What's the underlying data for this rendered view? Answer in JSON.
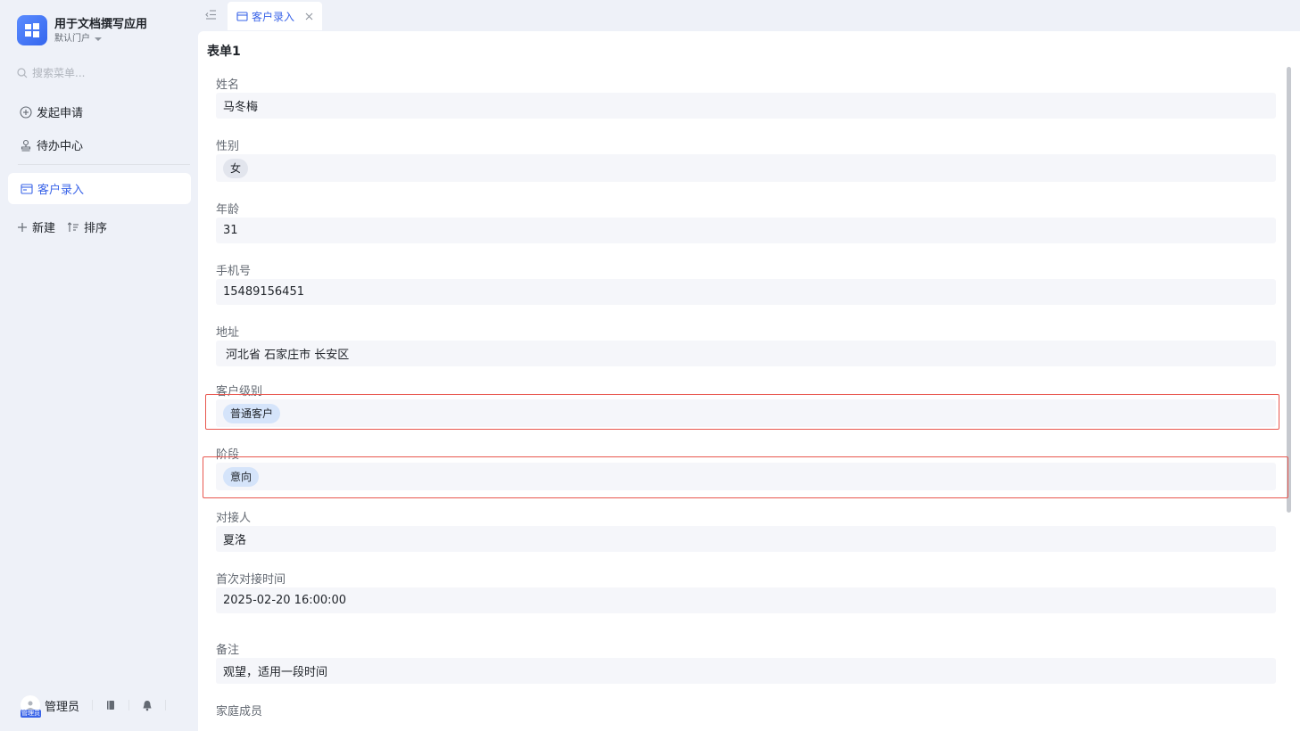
{
  "app": {
    "title": "用于文档撰写应用",
    "portal": "默认门户",
    "logo_icon": "windows-grid-icon"
  },
  "sidebar": {
    "search_placeholder": "搜索菜单...",
    "items": [
      {
        "label": "发起申请",
        "icon": "plus-circle-icon"
      },
      {
        "label": "待办中心",
        "icon": "stamp-icon"
      }
    ],
    "active_item": {
      "label": "客户录入",
      "icon": "form-icon"
    },
    "new_label": "新建",
    "sort_label": "排序",
    "user": {
      "name": "管理员",
      "avatar_tag": "管理员"
    }
  },
  "tabs": [
    {
      "label": "客户录入",
      "active": true
    }
  ],
  "form": {
    "title": "表单1",
    "fields": {
      "name": {
        "label": "姓名",
        "value": "马冬梅"
      },
      "gender": {
        "label": "性别",
        "value": "女"
      },
      "age": {
        "label": "年龄",
        "value": "31"
      },
      "phone": {
        "label": "手机号",
        "value": "15489156451"
      },
      "address": {
        "label": "地址",
        "value": "河北省 石家庄市 长安区"
      },
      "level": {
        "label": "客户级别",
        "value": "普通客户"
      },
      "stage": {
        "label": "阶段",
        "value": "意向"
      },
      "contact": {
        "label": "对接人",
        "value": "夏洛"
      },
      "first_time": {
        "label": "首次对接时间",
        "value": "2025-02-20 16:00:00"
      },
      "remark": {
        "label": "备注",
        "value": "观望，适用一段时间"
      },
      "family": {
        "label": "家庭成员"
      }
    }
  },
  "colors": {
    "accent": "#3a64e8",
    "highlight": "#e8574f",
    "field_bg": "#f5f6fa"
  }
}
